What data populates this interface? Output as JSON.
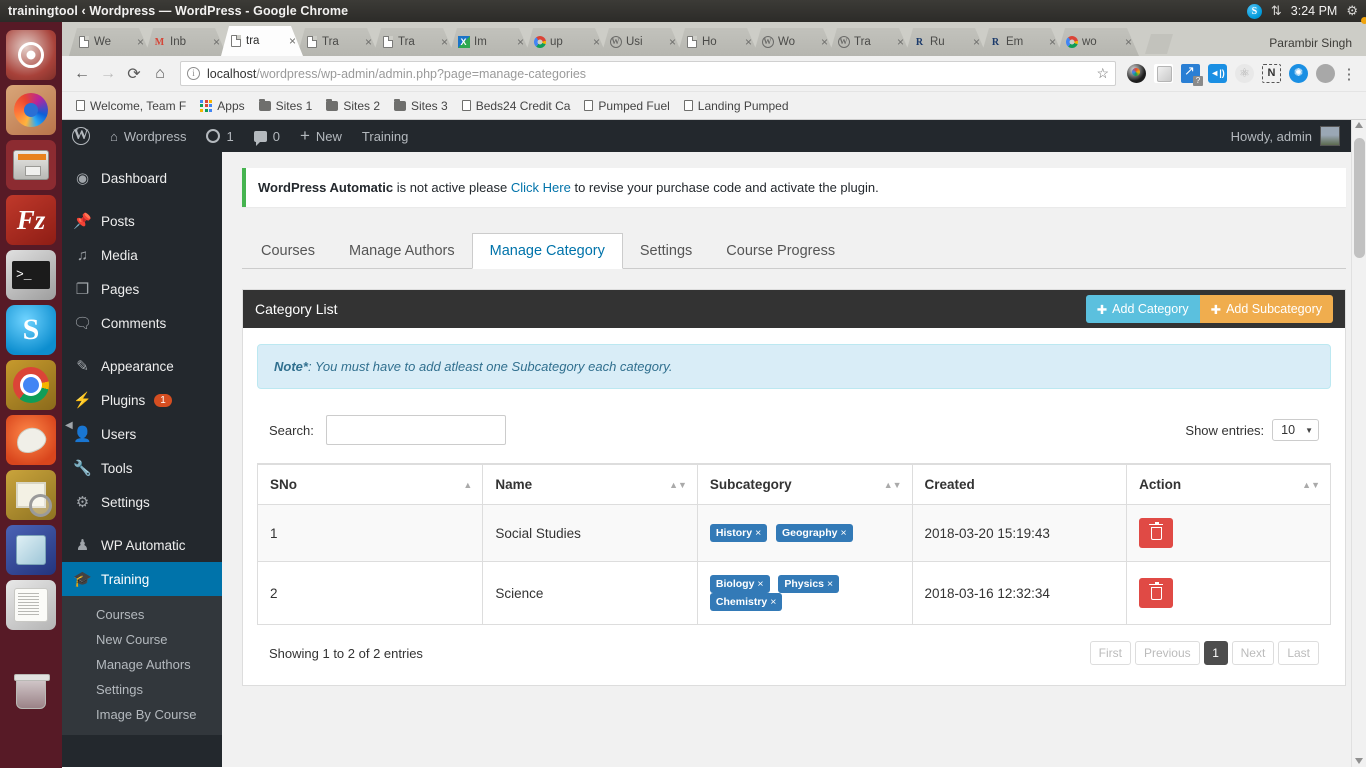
{
  "os": {
    "window_title": "trainingtool ‹ Wordpress — WordPress - Google Chrome",
    "tray": {
      "clock": "3:24 PM",
      "skype_icon": "skype-icon",
      "network_icon": "network-icon",
      "gear_icon": "gear-icon"
    },
    "launcher": [
      {
        "name": "ubuntu-dash-icon",
        "label": "Ubuntu"
      },
      {
        "name": "firefox-icon",
        "label": "Firefox"
      },
      {
        "name": "files-icon",
        "label": "Files"
      },
      {
        "name": "filezilla-icon",
        "label": "FileZilla"
      },
      {
        "name": "terminal-icon",
        "label": "Terminal"
      },
      {
        "name": "skype-icon",
        "label": "Skype"
      },
      {
        "name": "chrome-icon",
        "label": "Google Chrome"
      },
      {
        "name": "gimp-icon",
        "label": "GIMP"
      },
      {
        "name": "screenshot-icon",
        "label": "Shutter"
      },
      {
        "name": "virtualbox-icon",
        "label": "VirtualBox"
      },
      {
        "name": "text-editor-icon",
        "label": "Text Editor"
      },
      {
        "name": "trash-icon",
        "label": "Trash"
      }
    ]
  },
  "browser": {
    "tabs": [
      {
        "title": "We",
        "favicon": "document-icon",
        "active": false
      },
      {
        "title": "Inb",
        "favicon": "gmail-icon",
        "active": false
      },
      {
        "title": "tra",
        "favicon": "document-icon",
        "active": true
      },
      {
        "title": "Tra",
        "favicon": "document-icon",
        "active": false
      },
      {
        "title": "Tra",
        "favicon": "document-icon",
        "active": false
      },
      {
        "title": "Im",
        "favicon": "xampp-icon",
        "active": false
      },
      {
        "title": "up",
        "favicon": "google-icon",
        "active": false
      },
      {
        "title": "Usi",
        "favicon": "wordpress-icon",
        "active": false
      },
      {
        "title": "Ho",
        "favicon": "document-icon",
        "active": false
      },
      {
        "title": "Wo",
        "favicon": "wordpress-icon",
        "active": false
      },
      {
        "title": "Tra",
        "favicon": "wordpress-icon",
        "active": false
      },
      {
        "title": "Ru",
        "favicon": "rumble-icon",
        "active": false
      },
      {
        "title": "Em",
        "favicon": "rumble-icon",
        "active": false
      },
      {
        "title": "wo",
        "favicon": "google-icon",
        "active": false
      }
    ],
    "tab_close_label": "×",
    "profile_name": "Parambir Singh",
    "toolbar": {
      "back_icon": "back-arrow-icon",
      "forward_icon": "forward-arrow-icon",
      "reload_icon": "reload-icon",
      "home_icon": "home-icon",
      "star_icon": "bookmark-star-icon",
      "menu_icon": "kebab-menu-icon"
    },
    "address": {
      "url_host": "localhost",
      "url_path": "/wordpress/wp-admin/admin.php?page=manage-categories",
      "info_icon": "page-info-icon"
    },
    "bookmarks": [
      {
        "label": "Welcome, Team F",
        "icon": "document-icon"
      },
      {
        "label": "Apps",
        "icon": "apps-grid-icon"
      },
      {
        "label": "Sites 1",
        "icon": "folder-icon"
      },
      {
        "label": "Sites 2",
        "icon": "folder-icon"
      },
      {
        "label": "Sites 3",
        "icon": "folder-icon"
      },
      {
        "label": "Beds24 Credit Ca",
        "icon": "document-icon"
      },
      {
        "label": "Pumped Fuel",
        "icon": "document-icon"
      },
      {
        "label": "Landing Pumped",
        "icon": "document-icon"
      }
    ],
    "extensions": [
      "color-picker-ext-icon",
      "cube-ext-icon",
      "analytics-ext-icon",
      "tag-ext-icon",
      "react-devtools-ext-icon",
      "notion-ext-icon",
      "globe-ext-icon",
      "cloud-ext-icon"
    ]
  },
  "wp_adminbar": {
    "logo_icon": "wordpress-logo-icon",
    "site_name": "Wordpress",
    "updates_count": "1",
    "comments_count": "0",
    "new_label": "New",
    "training_label": "Training",
    "howdy": "Howdy, admin"
  },
  "wp_menu": {
    "items": [
      {
        "label": "Dashboard",
        "icon": "dashboard-icon",
        "active": false
      },
      {
        "label": "Posts",
        "icon": "pin-icon",
        "active": false
      },
      {
        "label": "Media",
        "icon": "media-icon",
        "active": false
      },
      {
        "label": "Pages",
        "icon": "pages-icon",
        "active": false
      },
      {
        "label": "Comments",
        "icon": "comment-icon",
        "active": false
      },
      {
        "label": "Appearance",
        "icon": "brush-icon",
        "active": false
      },
      {
        "label": "Plugins",
        "icon": "plugin-icon",
        "badge": "1",
        "active": false
      },
      {
        "label": "Users",
        "icon": "user-icon",
        "active": false
      },
      {
        "label": "Tools",
        "icon": "wrench-icon",
        "active": false
      },
      {
        "label": "Settings",
        "icon": "settings-sliders-icon",
        "active": false
      },
      {
        "label": "WP Automatic",
        "icon": "wp-automatic-icon",
        "active": false
      },
      {
        "label": "Training",
        "icon": "graduation-cap-icon",
        "active": true
      }
    ],
    "submenu": [
      "Courses",
      "New Course",
      "Manage Authors",
      "Settings",
      "Image By Course"
    ]
  },
  "notice": {
    "strong": "WordPress Automatic",
    "text_before_link": " is not active please ",
    "link": "Click Here",
    "text_after_link": " to revise your purchase code and activate the plugin."
  },
  "nav_tabs": [
    {
      "label": "Courses",
      "active": false
    },
    {
      "label": "Manage Authors",
      "active": false
    },
    {
      "label": "Manage Category",
      "active": true
    },
    {
      "label": "Settings",
      "active": false
    },
    {
      "label": "Course Progress",
      "active": false
    }
  ],
  "panel": {
    "title": "Category List",
    "add_category_label": "Add Category",
    "add_subcategory_label": "Add Subcategory",
    "plus_icon": "plus-icon",
    "note_bold": "Note*",
    "note_text": ": You must have to add atleast one Subcategory each category."
  },
  "datatable": {
    "search_label": "Search:",
    "search_value": "",
    "show_entries_label": "Show entries:",
    "entries_value": "10",
    "columns": [
      "SNo",
      "Name",
      "Subcategory",
      "Created",
      "Action"
    ],
    "rows": [
      {
        "sno": "1",
        "name": "Social Studies",
        "subcategories": [
          "History",
          "Geography"
        ],
        "created": "2018-03-20 15:19:43",
        "action_icon": "trash-icon"
      },
      {
        "sno": "2",
        "name": "Science",
        "subcategories": [
          "Biology",
          "Physics",
          "Chemistry"
        ],
        "created": "2018-03-16 12:32:34",
        "action_icon": "trash-icon"
      }
    ],
    "tag_remove_label": "×",
    "info": "Showing 1 to 2 of 2 entries",
    "pagination": [
      {
        "label": "First",
        "current": false
      },
      {
        "label": "Previous",
        "current": false
      },
      {
        "label": "1",
        "current": true
      },
      {
        "label": "Next",
        "current": false
      },
      {
        "label": "Last",
        "current": false
      }
    ]
  },
  "colors": {
    "wp_admin_dark": "#23282d",
    "wp_blue": "#0073aa",
    "panel_head": "#333333",
    "btn_info": "#5bc0de",
    "btn_warn": "#f0ad4e",
    "tag_blue": "#337ab7",
    "delete_red": "#e04a45",
    "note_bg": "#d9edf7",
    "notice_green": "#46b450"
  }
}
